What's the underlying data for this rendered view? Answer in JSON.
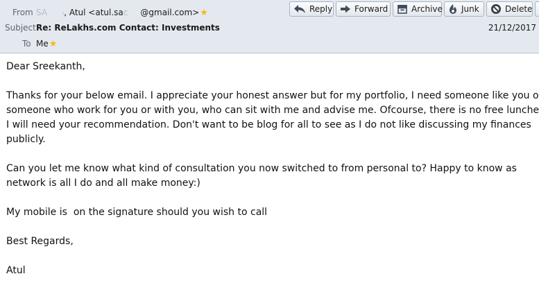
{
  "header": {
    "from_label": "From",
    "from_name_redacted": "SA",
    "from_mid_redacted": "ᵢ",
    "from_name_visible": ", Atul <atul.sa",
    "from_email_redacted": "c",
    "from_email_tail": "@gmail.com>",
    "subject_label": "Subject",
    "subject": "Re: ReLakhs.com Contact: Investments",
    "date": "21/12/2017",
    "to_label": "To",
    "to": "Me"
  },
  "toolbar": {
    "reply_label": "Reply",
    "forward_label": "Forward",
    "archive_label": "Archive",
    "junk_label": "Junk",
    "delete_label": "Delete"
  },
  "icons": {
    "reply": "reply-arrow-icon",
    "forward": "forward-arrow-icon",
    "archive": "archive-box-icon",
    "junk": "junk-flame-icon",
    "delete": "delete-circle-icon",
    "star": "star-icon"
  },
  "colors": {
    "header_bg": "#e4e9f0",
    "star": "#f3b81b",
    "delete_icon": "#3b3f45"
  },
  "message": {
    "greeting": "Dear Sreekanth,",
    "p1_l1": "Thanks for your below email. I appreciate your honest answer but for my portfolio, I need someone like you or",
    "p1_l2": "someone who work for you or with you, who can sit with me and advise me. Ofcourse, there is no free lunches",
    "p1_l3": "I will need your recommendation. Don't want to be blog for all to see as I do not like discussing my finances",
    "p1_l4": "publicly.",
    "p2_l1": "Can you let me know what kind of consultation you now switched to from personal to? Happy to know as",
    "p2_l2": "network is all I do and all make money:)",
    "p3": "My mobile is  on the signature should you wish to call",
    "closing": "Best Regards,",
    "signature": "Atul"
  }
}
